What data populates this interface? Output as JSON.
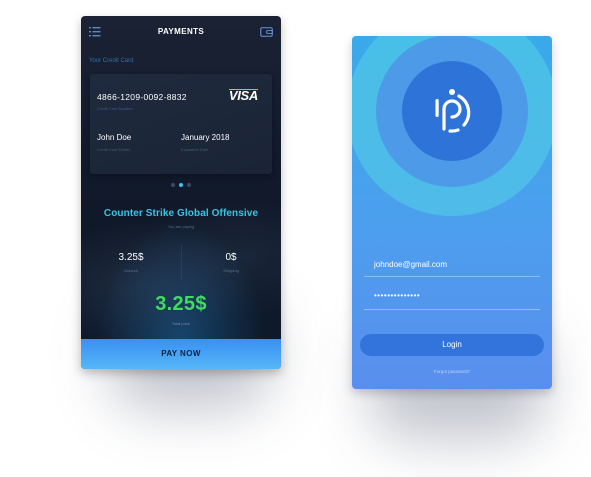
{
  "payments": {
    "header": {
      "title": "PAYMENTS",
      "menu_icon": "menu-list-icon",
      "wallet_icon": "wallet-icon"
    },
    "section_label": "Your Credit Card",
    "card": {
      "number": "4866-1209-0092-8832",
      "number_caption": "Credit Card Number",
      "brand": "VISA",
      "holder_name": "John Doe",
      "holder_caption": "Credit Card Holder",
      "expiry": "January 2018",
      "expiry_caption": "Expiration Date"
    },
    "carousel": {
      "count": 3,
      "active_index": 1
    },
    "item_title": "Counter Strike Global Offensive",
    "item_subtitle": "You are paying",
    "amount": {
      "value": "3.25$",
      "caption": "Amount"
    },
    "shipping": {
      "value": "0$",
      "caption": "Shipping"
    },
    "total": {
      "value": "3.25$",
      "caption": "Total price"
    },
    "pay_button": "PAY NOW"
  },
  "login": {
    "logo_icon": "p-logo-icon",
    "email_value": "johndoe@gmail.com",
    "password_value": "••••••••••••••",
    "login_button": "Login",
    "forgot_link": "Forgot password?"
  },
  "colors": {
    "accent_cyan": "#39c4e6",
    "total_green": "#3fdc5f",
    "login_button": "#3273dc",
    "visa_accent": "#f2a53a"
  }
}
